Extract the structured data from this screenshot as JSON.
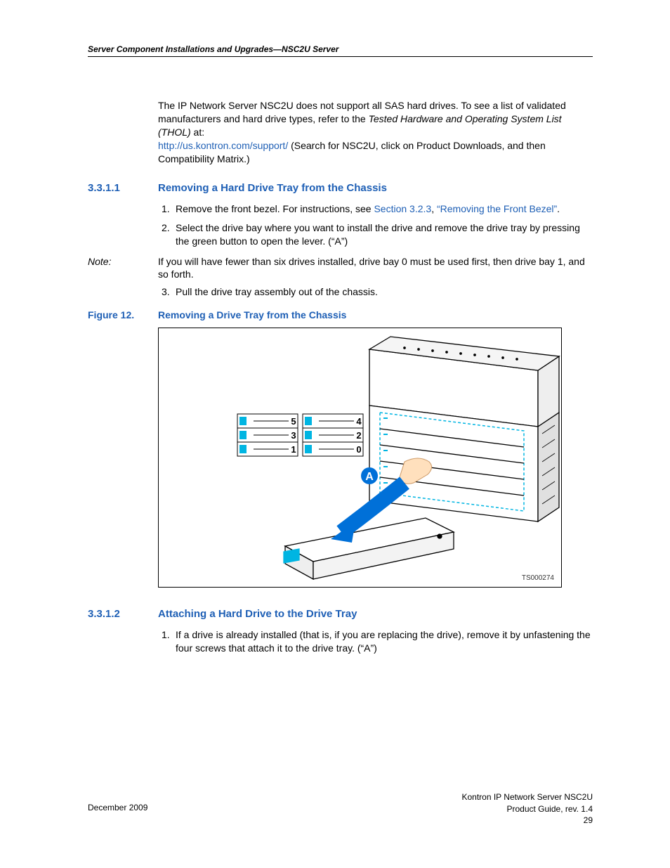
{
  "header": {
    "running": "Server Component Installations and Upgrades—NSC2U Server"
  },
  "intro": {
    "p1a": "The IP Network Server NSC2U does not support all SAS hard drives. To see a list of validated manufacturers and hard drive types, refer to the ",
    "p1_italic": "Tested Hardware and Operating System List (THOL)",
    "p1b": " at:",
    "link": "http://us.kontron.com/support/",
    "p1c": " (Search for NSC2U, click on Product Downloads, and then Compatibility Matrix.)"
  },
  "section1": {
    "num": "3.3.1.1",
    "title": "Removing a Hard Drive Tray from the Chassis",
    "steps": [
      {
        "n": "1.",
        "pre": "Remove the front bezel. For instructions, see ",
        "link1": "Section 3.2.3",
        "mid": ", ",
        "link2": "“Removing the Front Bezel”",
        "post": "."
      },
      {
        "n": "2.",
        "text": "Select the drive bay where you want to install the drive and remove the drive tray by pressing the green button to open the lever. (“A”)"
      }
    ],
    "note_label": "Note:",
    "note_body": "If you will have fewer than six drives installed, drive bay 0 must be used first, then drive bay 1, and so forth.",
    "step3_n": "3.",
    "step3_text": "Pull the drive tray assembly out of the chassis."
  },
  "figure": {
    "num": "Figure 12.",
    "title": "Removing a Drive Tray from the Chassis",
    "id": "TS000274",
    "marker": "A",
    "bay_labels": {
      "left": [
        "5",
        "3",
        "1"
      ],
      "right": [
        "4",
        "2",
        "0"
      ]
    }
  },
  "section2": {
    "num": "3.3.1.2",
    "title": "Attaching a Hard Drive to the Drive Tray",
    "steps": [
      {
        "n": "1.",
        "text": "If a drive is already installed (that is, if you are replacing the drive), remove it by unfastening the four screws that attach it to the drive tray. (“A”)"
      }
    ]
  },
  "footer": {
    "date": "December 2009",
    "product": "Kontron IP Network Server NSC2U",
    "guide": "Product Guide, rev. 1.4",
    "page": "29"
  }
}
